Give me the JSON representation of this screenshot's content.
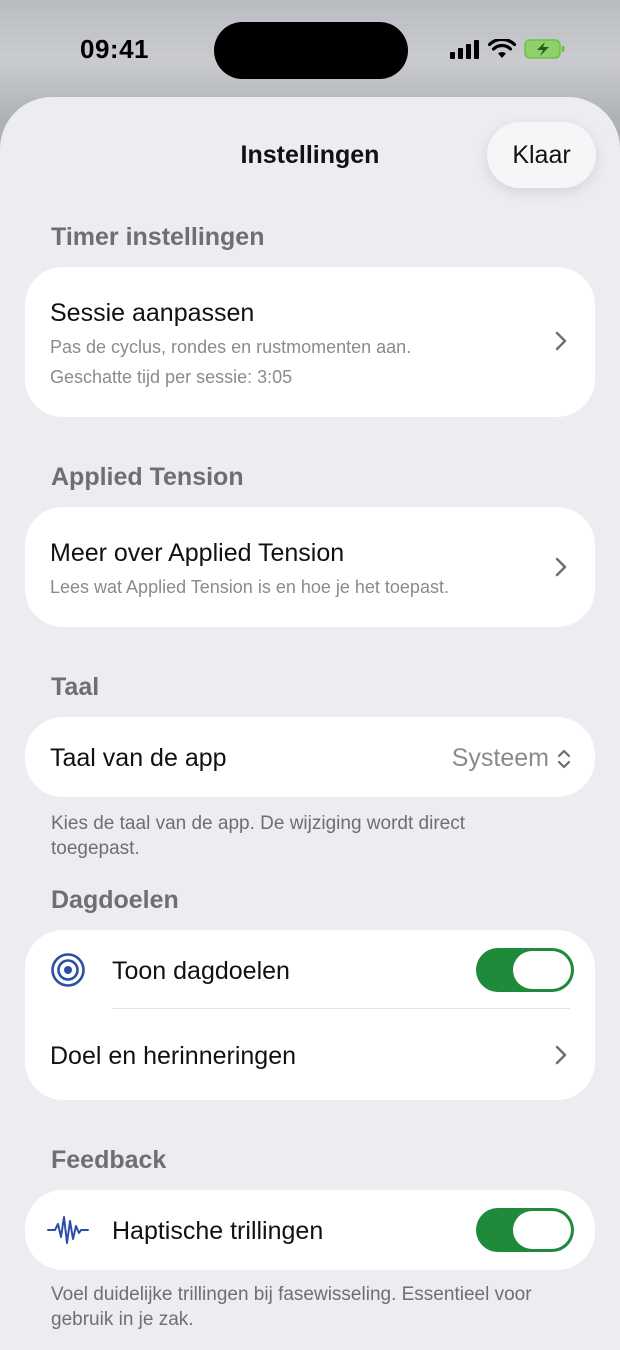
{
  "status": {
    "time": "09:41"
  },
  "header": {
    "title": "Instellingen",
    "done_label": "Klaar"
  },
  "timer": {
    "section": "Timer instellingen",
    "title": "Sessie aanpassen",
    "subtitle": "Pas de cyclus, rondes en rustmomenten aan.",
    "estimate": "Geschatte tijd per sessie: 3:05"
  },
  "tension": {
    "section": "Applied Tension",
    "title": "Meer over Applied Tension",
    "subtitle": "Lees wat Applied Tension is en hoe je het toepast."
  },
  "language": {
    "section": "Taal",
    "title": "Taal van de app",
    "value": "Systeem",
    "footnote": "Kies de taal van de app. De wijziging wordt direct toegepast."
  },
  "goals": {
    "section": "Dagdoelen",
    "toggle_label": "Toon dagdoelen",
    "toggle_on": true,
    "link_label": "Doel en herinneringen"
  },
  "feedback": {
    "section": "Feedback",
    "toggle_label": "Haptische trillingen",
    "toggle_on": true,
    "footnote": "Voel duidelijke trillingen bij fasewisseling. Essentieel voor gebruik in je zak."
  },
  "colors": {
    "accent_green": "#1e8a3a",
    "icon_blue": "#2b4fa8"
  }
}
